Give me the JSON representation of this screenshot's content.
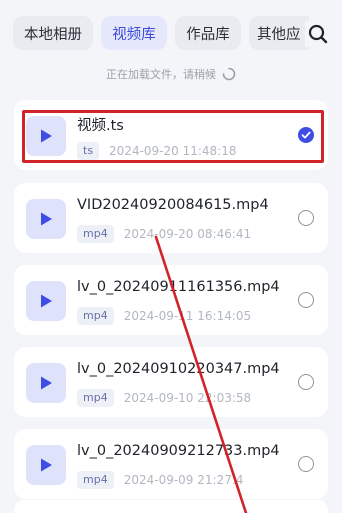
{
  "tabs": [
    {
      "label": "本地相册",
      "active": false
    },
    {
      "label": "视频库",
      "active": true
    },
    {
      "label": "作品库",
      "active": false
    },
    {
      "label": "其他应",
      "active": false
    }
  ],
  "search": {
    "icon": "search-icon"
  },
  "status": {
    "loading_text": "正在加载文件，请稍候"
  },
  "files": [
    {
      "name": "视频.ts",
      "ext": "ts",
      "time": "2024-09-20 11:48:18",
      "selected": true
    },
    {
      "name": "VID20240920084615.mp4",
      "ext": "mp4",
      "time": "2024-09-20 08:46:41",
      "selected": false
    },
    {
      "name": "lv_0_20240911161356.mp4",
      "ext": "mp4",
      "time": "2024-09-11 16:14:05",
      "selected": false
    },
    {
      "name": "lv_0_20240910220347.mp4",
      "ext": "mp4",
      "time": "2024-09-10 22:03:58",
      "selected": false
    },
    {
      "name": "lv_0_20240909212733.mp4",
      "ext": "mp4",
      "time": "2024-09-09 21:27:4",
      "selected": false
    }
  ],
  "colors": {
    "accent": "#3f4de3",
    "annotation": "#d2232a"
  }
}
